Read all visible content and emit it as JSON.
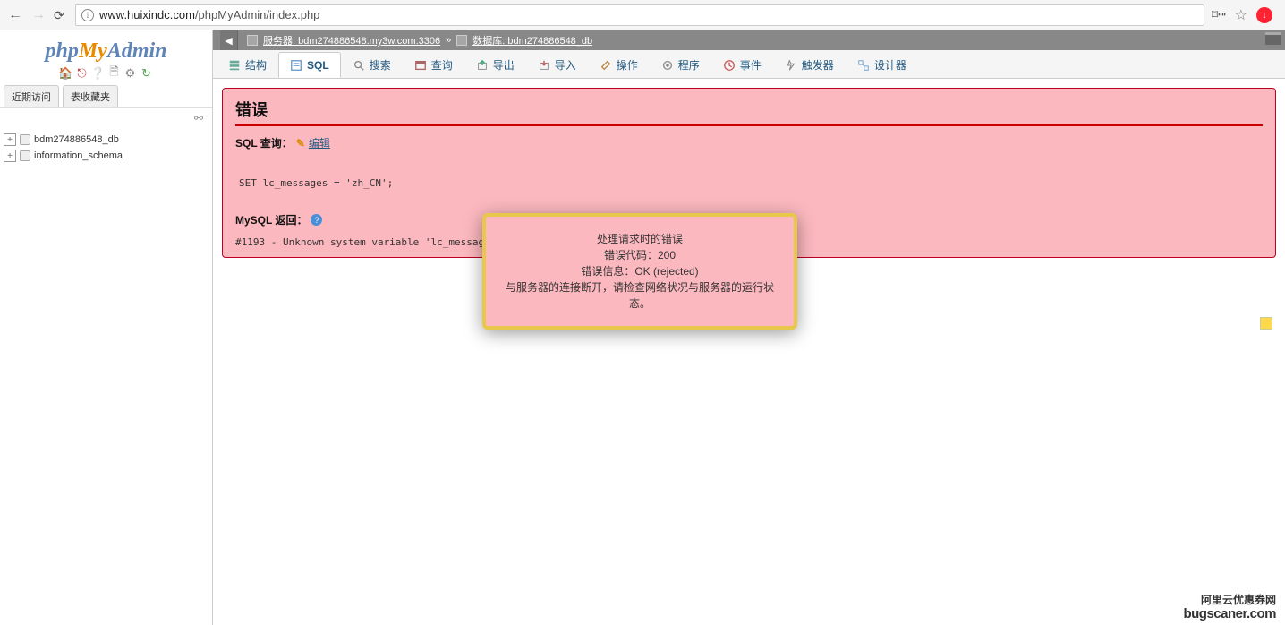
{
  "browser": {
    "url_host": "www.huixindc.com",
    "url_path": "/phpMyAdmin/index.php"
  },
  "logo": {
    "p1": "php",
    "p2": "My",
    "p3": "Admin"
  },
  "sidebar": {
    "tabs": [
      "近期访问",
      "表收藏夹"
    ],
    "tree": [
      {
        "label": "bdm274886548_db"
      },
      {
        "label": "information_schema"
      }
    ]
  },
  "srv": {
    "server_label": "服务器: bdm274886548.my3w.com:3306",
    "sep": "»",
    "db_label": "数据库: bdm274886548_db"
  },
  "tabs": [
    {
      "label": "结构"
    },
    {
      "label": "SQL"
    },
    {
      "label": "搜索"
    },
    {
      "label": "查询"
    },
    {
      "label": "导出"
    },
    {
      "label": "导入"
    },
    {
      "label": "操作"
    },
    {
      "label": "程序"
    },
    {
      "label": "事件"
    },
    {
      "label": "触发器"
    },
    {
      "label": "设计器"
    }
  ],
  "error": {
    "title": "错误",
    "sql_label": "SQL 查询：",
    "edit": "编辑",
    "code": "SET lc_messages = 'zh_CN';",
    "mysql_label": "MySQL 返回：",
    "msg": "#1193 - Unknown system variable 'lc_messages'"
  },
  "modal": {
    "l1": "处理请求时的错误",
    "l2": "错误代码：200",
    "l3": "错误信息：OK (rejected)",
    "l4": "与服务器的连接断开，请检查网络状况与服务器的运行状态。"
  },
  "branding": {
    "l1": "阿里云优惠券网",
    "l2": "bugscaner.com"
  }
}
